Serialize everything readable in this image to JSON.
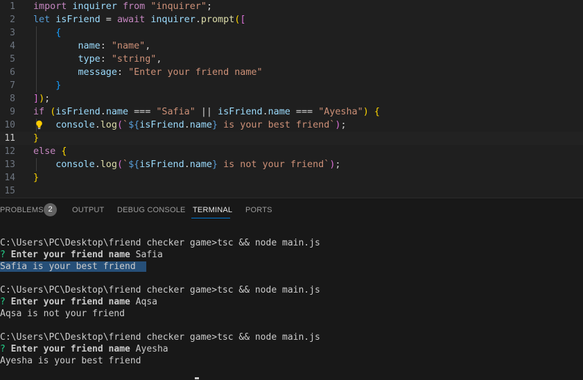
{
  "editor": {
    "lines": [
      {
        "n": "1",
        "tokens": [
          {
            "t": "import",
            "c": "k"
          },
          {
            "t": " inquirer ",
            "c": "v"
          },
          {
            "t": "from",
            "c": "k"
          },
          {
            "t": " ",
            "c": "o"
          },
          {
            "t": "\"inquirer\"",
            "c": "s"
          },
          {
            "t": ";",
            "c": "o"
          }
        ]
      },
      {
        "n": "2",
        "tokens": [
          {
            "t": "let",
            "c": "kb"
          },
          {
            "t": " ",
            "c": "o"
          },
          {
            "t": "isFriend",
            "c": "v"
          },
          {
            "t": " = ",
            "c": "o"
          },
          {
            "t": "await",
            "c": "k"
          },
          {
            "t": " ",
            "c": "o"
          },
          {
            "t": "inquirer",
            "c": "v"
          },
          {
            "t": ".",
            "c": "o"
          },
          {
            "t": "prompt",
            "c": "f"
          },
          {
            "t": "(",
            "c": "p"
          },
          {
            "t": "[",
            "c": "p2"
          }
        ]
      },
      {
        "n": "3",
        "tokens": [
          {
            "t": "    ",
            "c": "o"
          },
          {
            "t": "{",
            "c": "p3"
          }
        ]
      },
      {
        "n": "4",
        "tokens": [
          {
            "t": "        ",
            "c": "o"
          },
          {
            "t": "name",
            "c": "v"
          },
          {
            "t": ": ",
            "c": "o"
          },
          {
            "t": "\"name\"",
            "c": "s"
          },
          {
            "t": ",",
            "c": "o"
          }
        ]
      },
      {
        "n": "5",
        "tokens": [
          {
            "t": "        ",
            "c": "o"
          },
          {
            "t": "type",
            "c": "v"
          },
          {
            "t": ": ",
            "c": "o"
          },
          {
            "t": "\"string\"",
            "c": "s"
          },
          {
            "t": ",",
            "c": "o"
          }
        ]
      },
      {
        "n": "6",
        "tokens": [
          {
            "t": "        ",
            "c": "o"
          },
          {
            "t": "message",
            "c": "v"
          },
          {
            "t": ": ",
            "c": "o"
          },
          {
            "t": "\"Enter your friend name\"",
            "c": "s"
          }
        ]
      },
      {
        "n": "7",
        "tokens": [
          {
            "t": "    ",
            "c": "o"
          },
          {
            "t": "}",
            "c": "p3"
          }
        ]
      },
      {
        "n": "8",
        "tokens": [
          {
            "t": "]",
            "c": "p2"
          },
          {
            "t": ")",
            "c": "p"
          },
          {
            "t": ";",
            "c": "o"
          }
        ]
      },
      {
        "n": "9",
        "tokens": [
          {
            "t": "if",
            "c": "k"
          },
          {
            "t": " ",
            "c": "o"
          },
          {
            "t": "(",
            "c": "p"
          },
          {
            "t": "isFriend",
            "c": "v"
          },
          {
            "t": ".",
            "c": "o"
          },
          {
            "t": "name",
            "c": "v"
          },
          {
            "t": " === ",
            "c": "o"
          },
          {
            "t": "\"Safia\"",
            "c": "s"
          },
          {
            "t": " || ",
            "c": "o"
          },
          {
            "t": "isFriend",
            "c": "v"
          },
          {
            "t": ".",
            "c": "o"
          },
          {
            "t": "name",
            "c": "v"
          },
          {
            "t": " === ",
            "c": "o"
          },
          {
            "t": "\"Ayesha\"",
            "c": "s"
          },
          {
            "t": ")",
            "c": "p"
          },
          {
            "t": " ",
            "c": "o"
          },
          {
            "t": "{",
            "c": "p"
          }
        ]
      },
      {
        "n": "10",
        "tokens": [
          {
            "t": "    ",
            "c": "o"
          },
          {
            "t": "console",
            "c": "v"
          },
          {
            "t": ".",
            "c": "o"
          },
          {
            "t": "log",
            "c": "f"
          },
          {
            "t": "(",
            "c": "p2"
          },
          {
            "t": "`",
            "c": "s"
          },
          {
            "t": "${",
            "c": "kb"
          },
          {
            "t": "isFriend",
            "c": "v"
          },
          {
            "t": ".",
            "c": "o"
          },
          {
            "t": "name",
            "c": "v"
          },
          {
            "t": "}",
            "c": "kb"
          },
          {
            "t": " is your best friend`",
            "c": "s"
          },
          {
            "t": ")",
            "c": "p2"
          },
          {
            "t": ";",
            "c": "o"
          }
        ]
      },
      {
        "n": "11",
        "tokens": [
          {
            "t": "}",
            "c": "p"
          }
        ]
      },
      {
        "n": "12",
        "tokens": [
          {
            "t": "else",
            "c": "k"
          },
          {
            "t": " ",
            "c": "o"
          },
          {
            "t": "{",
            "c": "p"
          }
        ]
      },
      {
        "n": "13",
        "tokens": [
          {
            "t": "    ",
            "c": "o"
          },
          {
            "t": "console",
            "c": "v"
          },
          {
            "t": ".",
            "c": "o"
          },
          {
            "t": "log",
            "c": "f"
          },
          {
            "t": "(",
            "c": "p2"
          },
          {
            "t": "`",
            "c": "s"
          },
          {
            "t": "${",
            "c": "kb"
          },
          {
            "t": "isFriend",
            "c": "v"
          },
          {
            "t": ".",
            "c": "o"
          },
          {
            "t": "name",
            "c": "v"
          },
          {
            "t": "}",
            "c": "kb"
          },
          {
            "t": " is not your friend`",
            "c": "s"
          },
          {
            "t": ")",
            "c": "p2"
          },
          {
            "t": ";",
            "c": "o"
          }
        ]
      },
      {
        "n": "14",
        "tokens": [
          {
            "t": "}",
            "c": "p"
          }
        ]
      },
      {
        "n": "15",
        "tokens": []
      }
    ],
    "current_line": "11"
  },
  "panel": {
    "tabs": {
      "problems": "PROBLEMS",
      "problems_count": "2",
      "output": "OUTPUT",
      "debug_console": "DEBUG CONSOLE",
      "terminal": "TERMINAL",
      "ports": "PORTS"
    },
    "terminal": {
      "run1": {
        "command": "C:\\Users\\PC\\Desktop\\friend checker game>tsc && node main.js",
        "prompt_mark": "?",
        "prompt_text": "Enter your friend name",
        "answer": "Safia",
        "result": "Safia is your best friend"
      },
      "run2": {
        "command": "C:\\Users\\PC\\Desktop\\friend checker game>tsc && node main.js",
        "prompt_mark": "?",
        "prompt_text": "Enter your friend name",
        "answer": "Aqsa",
        "result": "Aqsa is not your friend"
      },
      "run3": {
        "command": "C:\\Users\\PC\\Desktop\\friend checker game>tsc && node main.js",
        "prompt_mark": "?",
        "prompt_text": "Enter your friend name",
        "answer": "Ayesha",
        "result": "Ayesha is your best friend"
      }
    }
  },
  "colors": {
    "editor_bg": "#1f1f1f",
    "panel_bg": "#181818",
    "selection": "#264f78",
    "prompt_mark": "#23d18b",
    "active_tab_underline": "#0078d4"
  }
}
